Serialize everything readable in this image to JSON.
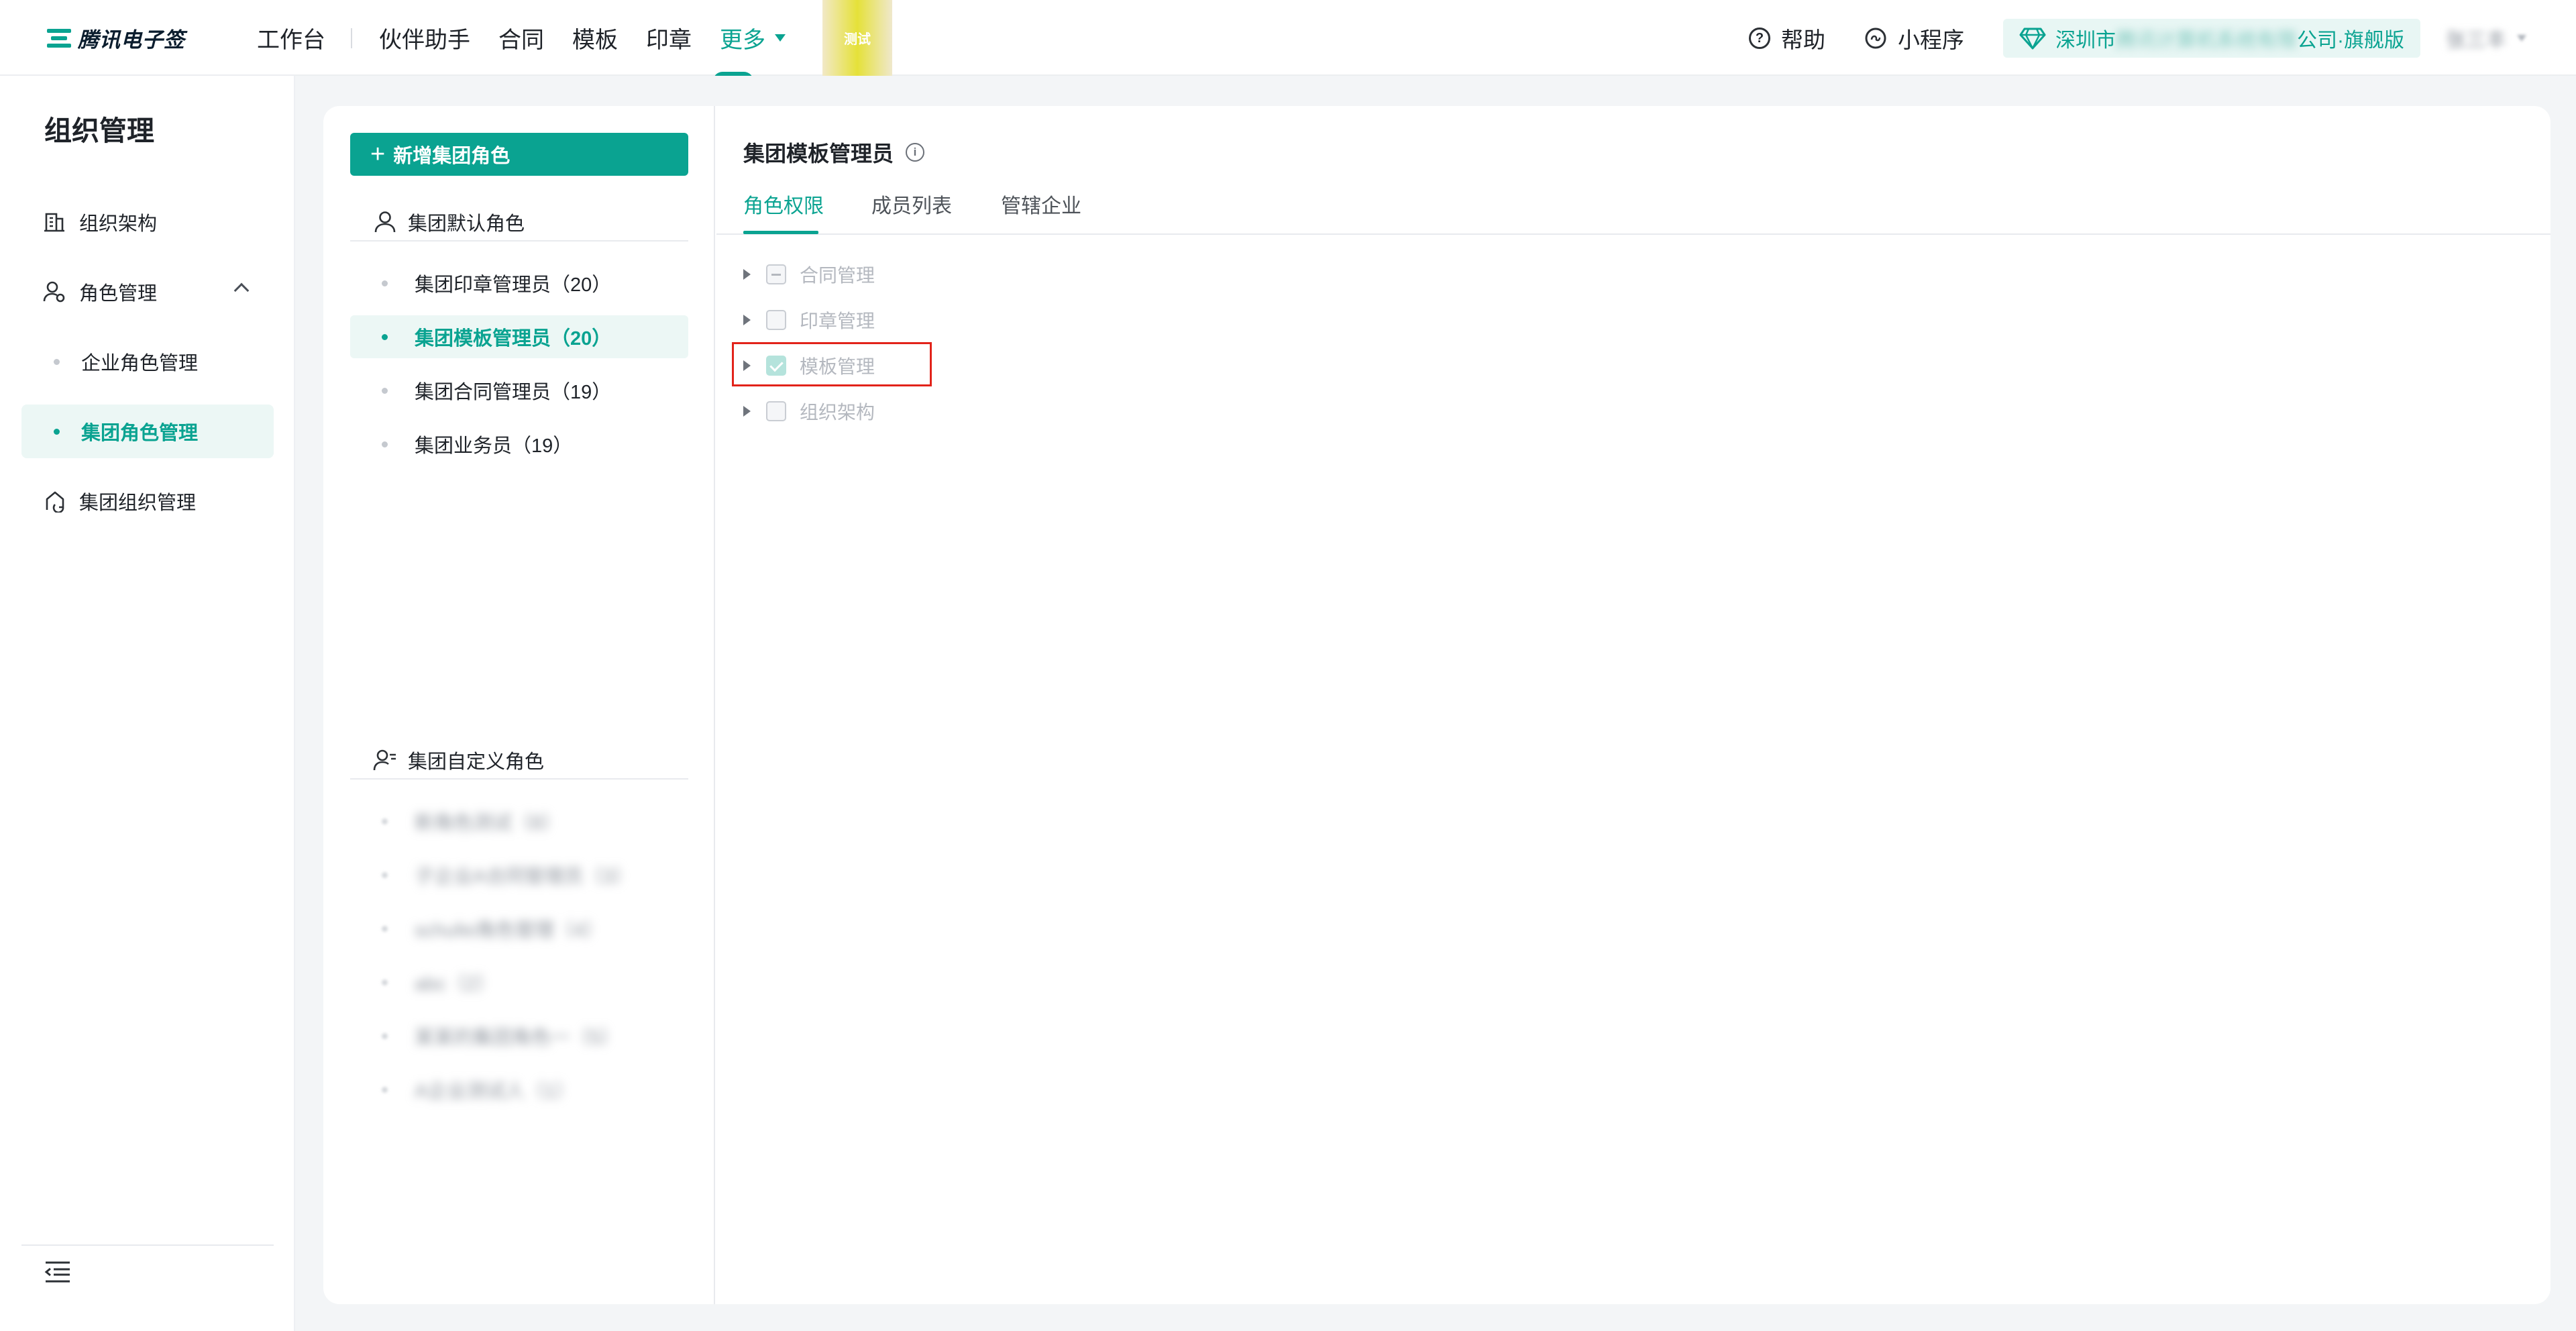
{
  "app": {
    "logo_text": "腾讯电子签",
    "brand_color": "#0aa391",
    "env_tag": "测试"
  },
  "top_nav": {
    "items": [
      "工作台",
      "伙伴助手",
      "合同",
      "模板",
      "印章"
    ],
    "more_label": "更多"
  },
  "top_right": {
    "help_label": "帮助",
    "miniprogram_label": "小程序",
    "org_prefix": "深圳市",
    "org_hidden": "腾讯计算机系统有限",
    "org_suffix": "公司·旗舰版",
    "user_name": "张三丰"
  },
  "sidebar": {
    "title": "组织管理",
    "items": [
      {
        "label": "组织架构",
        "icon": "building-icon"
      },
      {
        "label": "角色管理",
        "icon": "user-role-icon",
        "expanded": true
      },
      {
        "label": "企业角色管理",
        "sub": true
      },
      {
        "label": "集团角色管理",
        "sub": true,
        "active": true
      },
      {
        "label": "集团组织管理",
        "icon": "group-org-icon"
      }
    ]
  },
  "role_panel": {
    "add_button": "新增集团角色",
    "default_group": {
      "title": "集团默认角色",
      "roles": [
        {
          "label": "集团印章管理员（20）"
        },
        {
          "label": "集团模板管理员（20）",
          "active": true
        },
        {
          "label": "集团合同管理员（19）"
        },
        {
          "label": "集团业务员（19）"
        }
      ]
    },
    "custom_group": {
      "title": "集团自定义角色",
      "roles": [
        {
          "label": "新角色测试（8）"
        },
        {
          "label": "子企业A合同管理员（3）"
        },
        {
          "label": "schufei角色管理（4）"
        },
        {
          "label": "abc（2）"
        },
        {
          "label": "某某的集团角色一（5）"
        },
        {
          "label": "A企业测试人（1）"
        }
      ]
    }
  },
  "detail": {
    "title": "集团模板管理员",
    "tabs": [
      {
        "label": "角色权限",
        "active": true
      },
      {
        "label": "成员列表"
      },
      {
        "label": "管辖企业"
      }
    ],
    "permissions": [
      {
        "label": "合同管理",
        "state": "indeterminate"
      },
      {
        "label": "印章管理",
        "state": "unchecked"
      },
      {
        "label": "模板管理",
        "state": "checked",
        "highlighted": true
      },
      {
        "label": "组织架构",
        "state": "unchecked"
      }
    ]
  }
}
